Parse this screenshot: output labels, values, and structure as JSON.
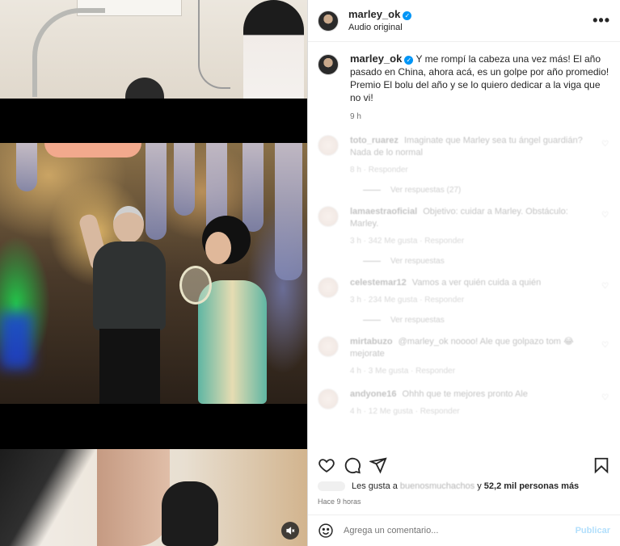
{
  "post": {
    "username": "marley_ok",
    "audio": "Audio original",
    "more_icon": "more-horizontal-icon",
    "verified_icon": "verified-badge-icon"
  },
  "caption": {
    "username": "marley_ok",
    "text": "Y me rompí la cabeza una vez más! El año pasado en China, ahora acá, es un golpe por año promedio! Premio El bolu del año y se lo quiero dedicar a la viga que no vi!",
    "time": "9 h"
  },
  "comments": [
    {
      "user": "toto_ruarez",
      "text": "Imaginate que Marley sea tu ángel guardián? Nada de lo normal",
      "meta": "8 h · Responder"
    },
    {
      "user": "lamaestraoficial",
      "text": "Objetivo: cuidar a Marley. Obstáculo: Marley.",
      "meta": "3 h · 342 Me gusta · Responder"
    },
    {
      "user": "celestemar12",
      "text": "Vamos a ver quién cuida a quién",
      "meta": "3 h · 234 Me gusta · Responder"
    },
    {
      "user": "mirtabuzo",
      "text": "@marley_ok noooo! Ale que golpazo tom 😂 mejorate",
      "meta": "4 h · 3 Me gusta · Responder"
    },
    {
      "user": "andyone16",
      "text": "Ohhh que te mejores pronto Ale",
      "meta": "4 h · 12 Me gusta · Responder"
    }
  ],
  "replies": [
    {
      "label": "Ver respuestas (27)"
    },
    {
      "label": "Ver respuestas"
    },
    {
      "label": "Ver respuestas"
    }
  ],
  "actions": {
    "like_icon": "heart-icon",
    "comment_icon": "comment-icon",
    "share_icon": "share-icon",
    "save_icon": "bookmark-icon"
  },
  "likes": {
    "prefix": "Les gusta a",
    "liker": "buenosmuchachos",
    "conjunction": "y",
    "count": "52,2 mil personas más"
  },
  "ago": "Hace 9 horas",
  "add_comment": {
    "placeholder": "Agrega un comentario...",
    "publish": "Publicar",
    "emoji_icon": "emoji-smile-icon"
  },
  "media": {
    "mute_icon": "speaker-muted-icon"
  }
}
